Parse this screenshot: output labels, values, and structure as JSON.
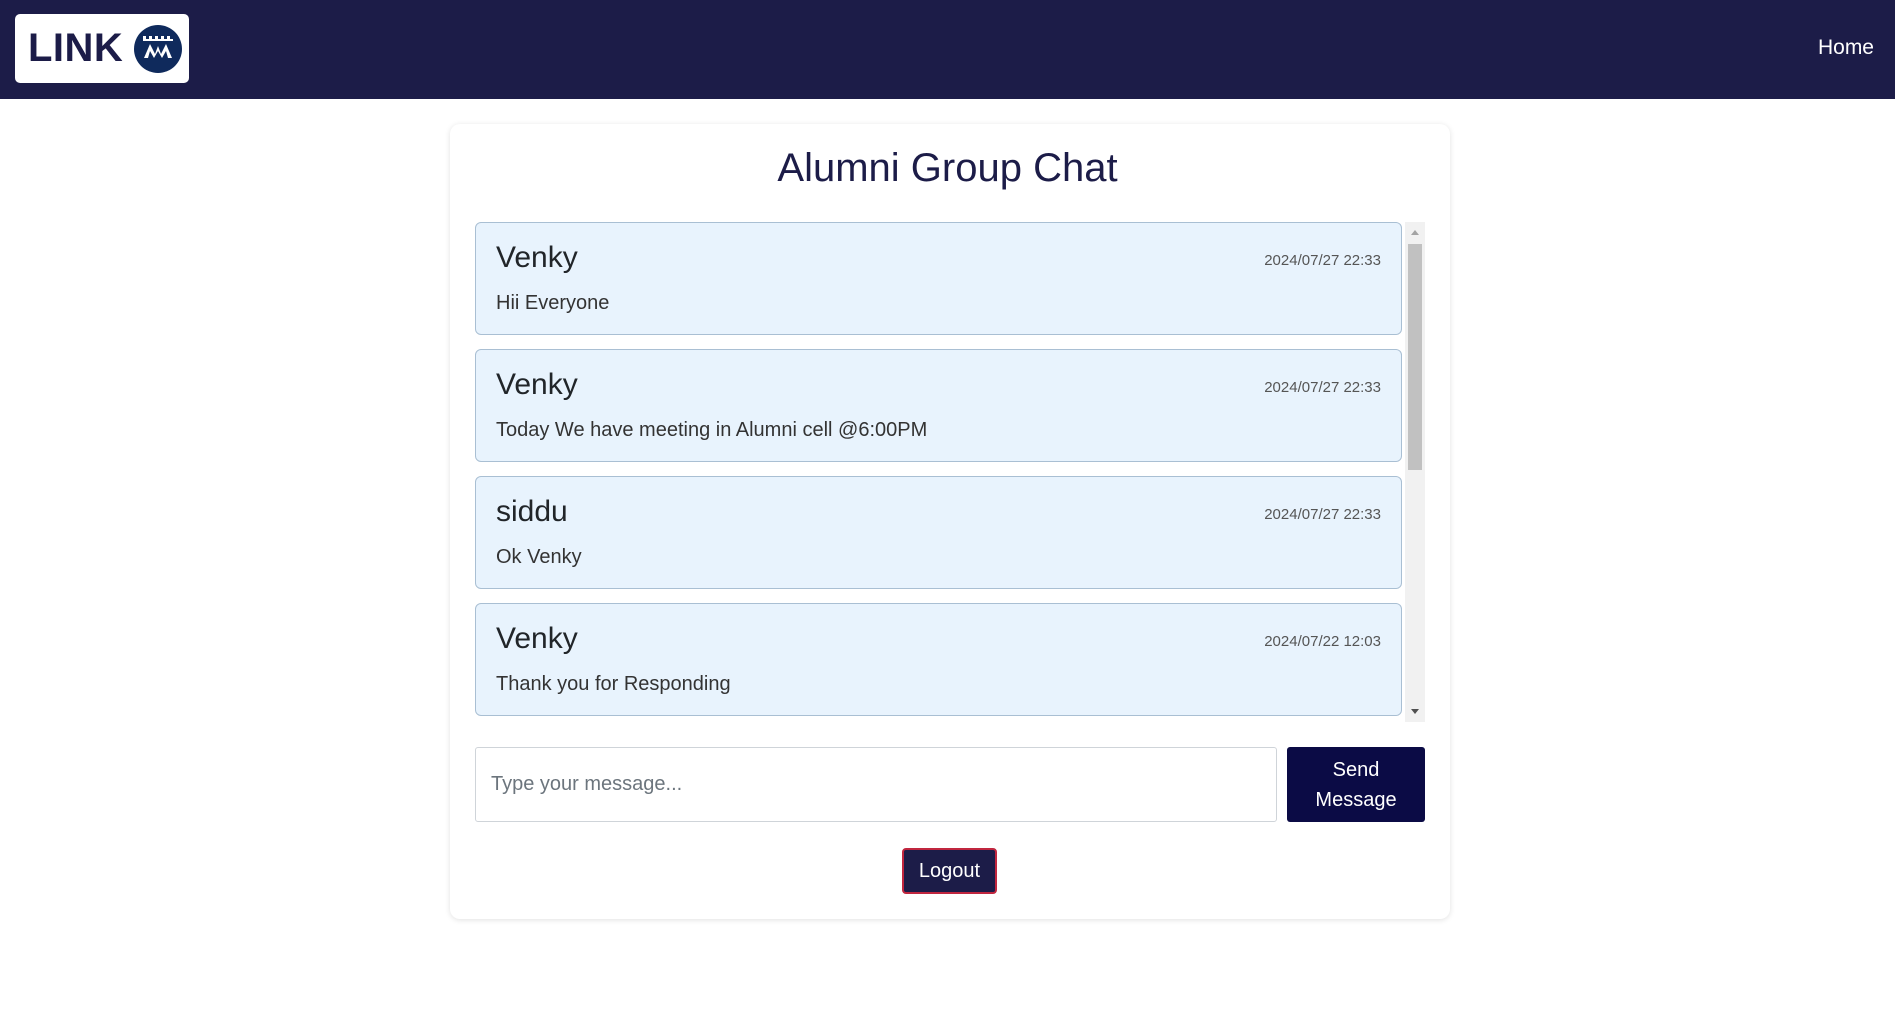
{
  "navbar": {
    "logo_text": "LINK",
    "home_label": "Home",
    "bg_color": "#1c1c48"
  },
  "chat": {
    "title": "Alumni Group Chat",
    "messages": [
      {
        "name": "Venky",
        "time": "2024/07/27 22:33",
        "text": "Hii Everyone"
      },
      {
        "name": "Venky",
        "time": "2024/07/27 22:33",
        "text": "Today We have meeting in Alumni cell @6:00PM"
      },
      {
        "name": "siddu",
        "time": "2024/07/27 22:33",
        "text": "Ok Venky"
      },
      {
        "name": "Venky",
        "time": "2024/07/22 12:03",
        "text": "Thank you for Responding"
      }
    ],
    "input_placeholder": "Type your message...",
    "send_label": "Send Message",
    "logout_label": "Logout",
    "message_bg_color": "#e8f3fd",
    "send_button_color": "#0b0b45",
    "logout_border_color": "#c0263f"
  }
}
